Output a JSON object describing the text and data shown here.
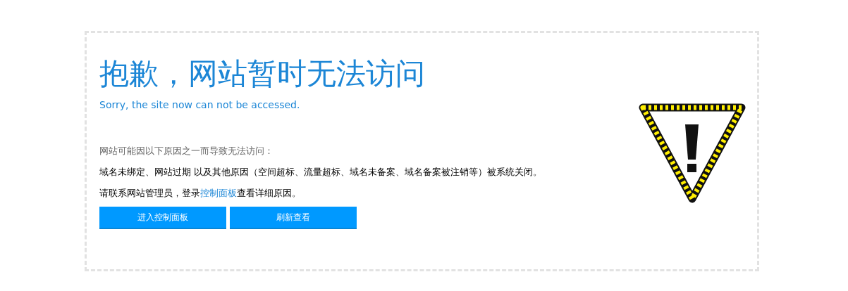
{
  "title": "抱歉，网站暂时无法访问",
  "subtitle": "Sorry, the site now can not be accessed.",
  "reasons_intro": "网站可能因以下原因之一而导致无法访问：",
  "reasons": "域名未绑定、网站过期 以及其他原因（空间超标、流量超标、域名未备案、域名备案被注销等）被系统关闭。",
  "contact": {
    "before": "请联系网站管理员，登录",
    "link": "控制面板",
    "after": "查看详细原因。"
  },
  "buttons": [
    "进入控制面板",
    "刷新查看"
  ]
}
